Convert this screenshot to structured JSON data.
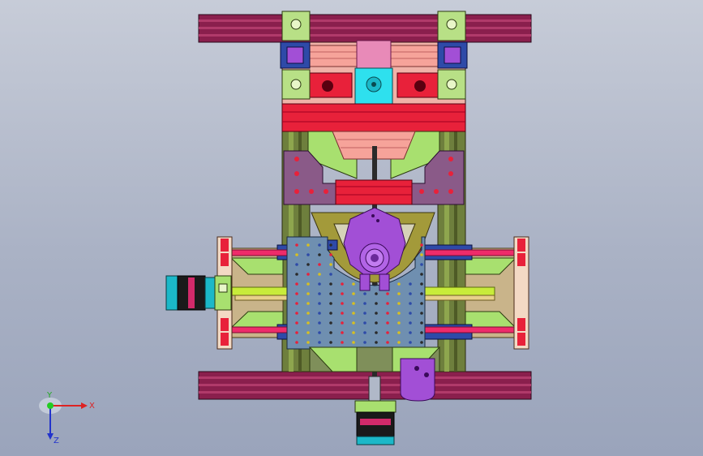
{
  "view": {
    "background_top": "#c7ccd8",
    "background_bottom": "#9aa4bb"
  },
  "colors": {
    "frame_bar": "#8a1f4d",
    "red_block": "#e8213a",
    "salmon": "#f6a39a",
    "light_green": "#a8e06f",
    "purple_plate": "#8a5a88",
    "steel_blue": "#6f8fb0",
    "dark_blue": "#2e4aa8",
    "magenta": "#a24fd6",
    "pink_rod": "#ee2c6a",
    "motor_black": "#1a1a1a",
    "motor_cyan": "#1bb8c8",
    "cyan_block": "#2ee0ee",
    "olive": "#a39a3a"
  },
  "triad": {
    "x_label": "X",
    "y_label": "Y",
    "z_label": "Z"
  }
}
